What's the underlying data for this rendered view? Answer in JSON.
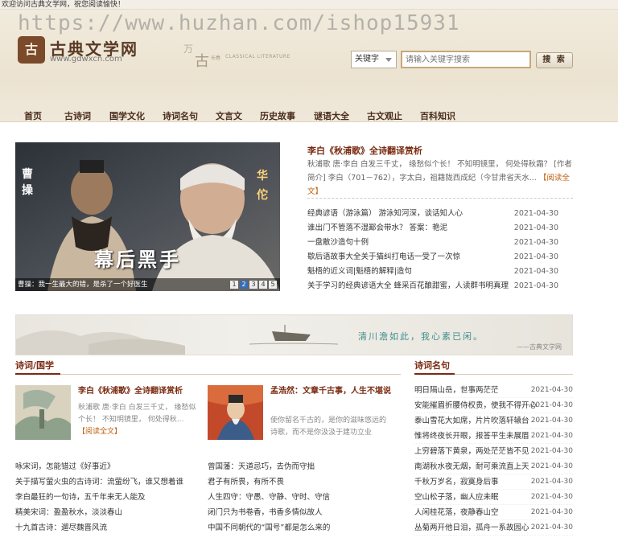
{
  "topbar": {
    "welcome": "欢迎访问古典文学网，祝您阅读愉快！"
  },
  "header": {
    "watermark": "https://www.huzhan.com/ishop15931",
    "logo_glyph": "古",
    "logo_cn": "古典文学网",
    "logo_url": "www.gdwxcn.com",
    "deco_1": "万",
    "deco_2": "古",
    "deco_3": "长春",
    "deco_4": "CLASSICAL LITERATURE"
  },
  "search": {
    "select_value": "关键字",
    "placeholder": "请输入关键字搜索",
    "button_label": "搜 索"
  },
  "nav": {
    "items": [
      "首页",
      "古诗词",
      "国学文化",
      "诗词名句",
      "文言文",
      "历史故事",
      "谜语大全",
      "古文观止",
      "百科知识"
    ]
  },
  "banner": {
    "label_left": "曹操",
    "label_right": "华佗",
    "overlay_title": "幕后黑手",
    "caption": "曹操：我一生最大的错，是杀了一个好医生",
    "pages": [
      "1",
      "2",
      "3",
      "4",
      "5"
    ],
    "active_page": 2
  },
  "featured": {
    "title": "李白《秋浦歌》全诗翻译赏析",
    "desc": "秋浦歌 唐·李白 白发三千丈， 缘愁似个长！ 不知明镜里， 何处得秋霜？ [作者简介] 李白（701－762），字太白，祖籍陇西成纪（今甘肃省天水...",
    "read_label": "阅读全文"
  },
  "news": [
    {
      "title": "经典谚语（游泳篇） 游泳知河深，谈话知人心",
      "date": "2021-04-30"
    },
    {
      "title": "谁出门不管落不湿鄙会带水？ 答案：艳泥",
      "date": "2021-04-30"
    },
    {
      "title": "一盘散沙造句十例",
      "date": "2021-04-30"
    },
    {
      "title": "歇后语故事大全关于猫纠打电话一受了一次惊",
      "date": "2021-04-30"
    },
    {
      "title": "魁梧的近义词|魁梧的解释|造句",
      "date": "2021-04-30"
    },
    {
      "title": "关于学习的经典谚语大全 蜂采百花酿甜蜜，人读群书明真理",
      "date": "2021-04-30"
    }
  ],
  "ad": {
    "slogan": "清川澹如此，我心素已闲。",
    "sign": "——古典文学网"
  },
  "poetry_section": {
    "title": "诗词/国学",
    "card1": {
      "title": "李白《秋浦歌》全诗翻译赏析",
      "desc": "秋浦歌 唐·李白 白发三千丈， 缘愁似个长！ 不知明镜里， 何处得秋...",
      "read_label": "阅读全文"
    },
    "card2": {
      "title": "孟浩然：文章千古事，人生不堪说",
      "desc": "使你留名千古的，是你的滋味悠远的诗歌，而不是你汲汲于建功立业"
    },
    "list_left": [
      "咏宋词，怎能错过《好事近》",
      "关于描写萤火虫的古诗词：流萤纷飞，谁又想着谁",
      "李白最狂的一句诗，五千年来无人能及",
      "精美宋词：盈盈秋水，淡淡春山",
      "十九首古诗：遛尽魏晋风流"
    ],
    "list_right": [
      "曾国藩：天道忌巧，去伪而守拙",
      "君子有所畏，有所不畏",
      "人生四守：守愚、守静、守时、守信",
      "闭门只为书卷香，书香多情似故人",
      "中国不同朝代的“国号”都是怎么来的"
    ]
  },
  "quotes_section": {
    "title": "诗词名句",
    "items": [
      {
        "title": "明日隔山岳，世事两茫茫",
        "date": "2021-04-30"
      },
      {
        "title": "安能摧眉折腰侍权贵，使我不得开心",
        "date": "2021-04-30"
      },
      {
        "title": "泰山雪花大如席，片片吹落轩辕台",
        "date": "2021-04-30"
      },
      {
        "title": "惟将终夜长开眼，报答平生未展眉",
        "date": "2021-04-30"
      },
      {
        "title": "上穷碧落下黄泉，两处茫茫皆不见",
        "date": "2021-04-30"
      },
      {
        "title": "南湖秋水夜无烟，耐可乘流直上天",
        "date": "2021-04-30"
      },
      {
        "title": "千秋万岁名，寂寞身后事",
        "date": "2021-04-30"
      },
      {
        "title": "空山松子落，幽人应未眠",
        "date": "2021-04-30"
      },
      {
        "title": "人闲桂花落，夜静春山空",
        "date": "2021-04-30"
      },
      {
        "title": "丛菊两开他日泪，孤舟一系故园心",
        "date": "2021-04-30"
      }
    ]
  }
}
